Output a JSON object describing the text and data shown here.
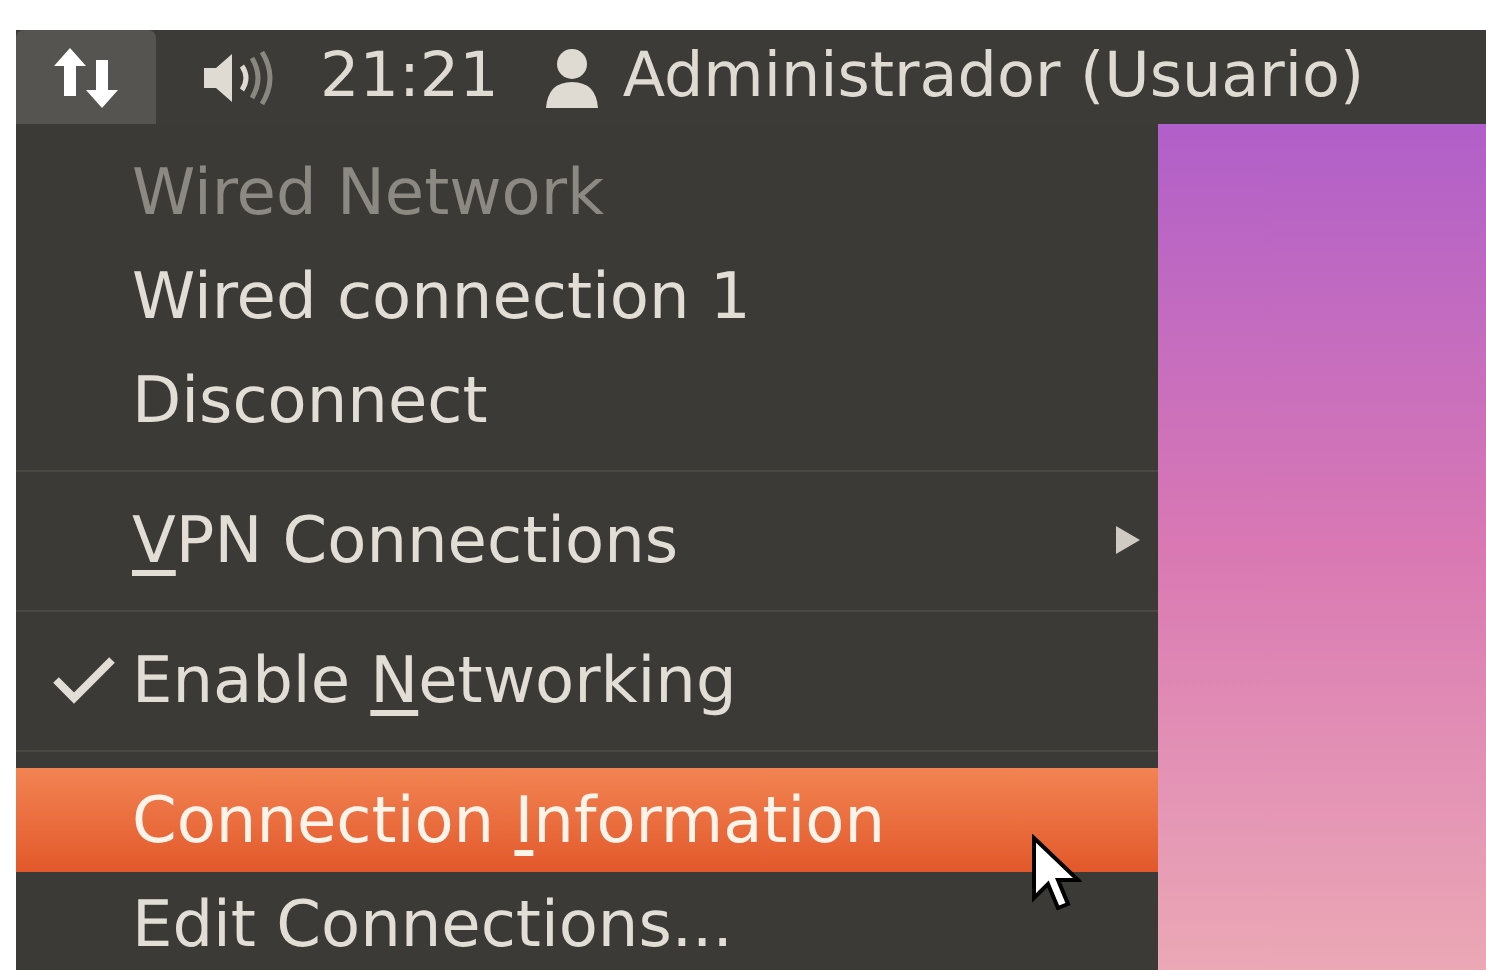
{
  "panel": {
    "network_button_selected": true,
    "clock": "21:21",
    "user": "Administrador (Usuario)"
  },
  "menu": {
    "items": [
      {
        "kind": "item",
        "before": "Wired Network",
        "disabled": true,
        "checked": false,
        "selected": false
      },
      {
        "kind": "item",
        "before": "Wired connection 1",
        "disabled": false,
        "checked": false,
        "selected": false
      },
      {
        "kind": "item",
        "before": "Disconnect",
        "disabled": false,
        "checked": false,
        "selected": false
      },
      {
        "kind": "separator"
      },
      {
        "kind": "submenu",
        "mnemonic": "V",
        "after": "PN Connections",
        "disabled": false,
        "checked": false,
        "selected": false
      },
      {
        "kind": "separator"
      },
      {
        "kind": "item",
        "before": "Enable ",
        "mnemonic": "N",
        "after": "etworking",
        "disabled": false,
        "checked": true,
        "selected": false
      },
      {
        "kind": "separator"
      },
      {
        "kind": "item",
        "before": "Connection ",
        "mnemonic": "I",
        "after": "nformation",
        "disabled": false,
        "checked": false,
        "selected": true
      },
      {
        "kind": "item",
        "before": "Edit Connections...",
        "disabled": false,
        "checked": false,
        "selected": false
      }
    ]
  }
}
